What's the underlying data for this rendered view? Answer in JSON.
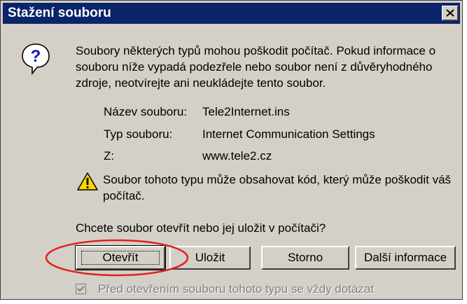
{
  "window": {
    "title": "Stažení souboru"
  },
  "message": "Soubory některých typů mohou poškodit počítač. Pokud informace o souboru níže vypadá podezřele nebo soubor není z důvěryhodného zdroje, neotvírejte ani neukládejte tento soubor.",
  "details": {
    "name_label": "Název souboru:",
    "name_value": "Tele2Internet.ins",
    "type_label": "Typ souboru:",
    "type_value": "Internet Communication Settings",
    "from_label": "Z:",
    "from_value": "www.tele2.cz"
  },
  "warning": "Soubor tohoto typu může obsahovat kód, který může poškodit váš počítač.",
  "question": "Chcete soubor otevřít nebo jej uložit v počítači?",
  "buttons": {
    "open": "Otevřít",
    "save": "Uložit",
    "cancel": "Storno",
    "more": "Další informace"
  },
  "checkbox": {
    "label": "Před otevřením souboru tohoto typu se vždy dotázat",
    "checked": true,
    "disabled": true
  },
  "annotation": {
    "color": "#e02020"
  },
  "icons": {
    "question": "question-icon",
    "warning": "warning-icon",
    "close": "close-icon",
    "check": "checkmark-icon"
  }
}
